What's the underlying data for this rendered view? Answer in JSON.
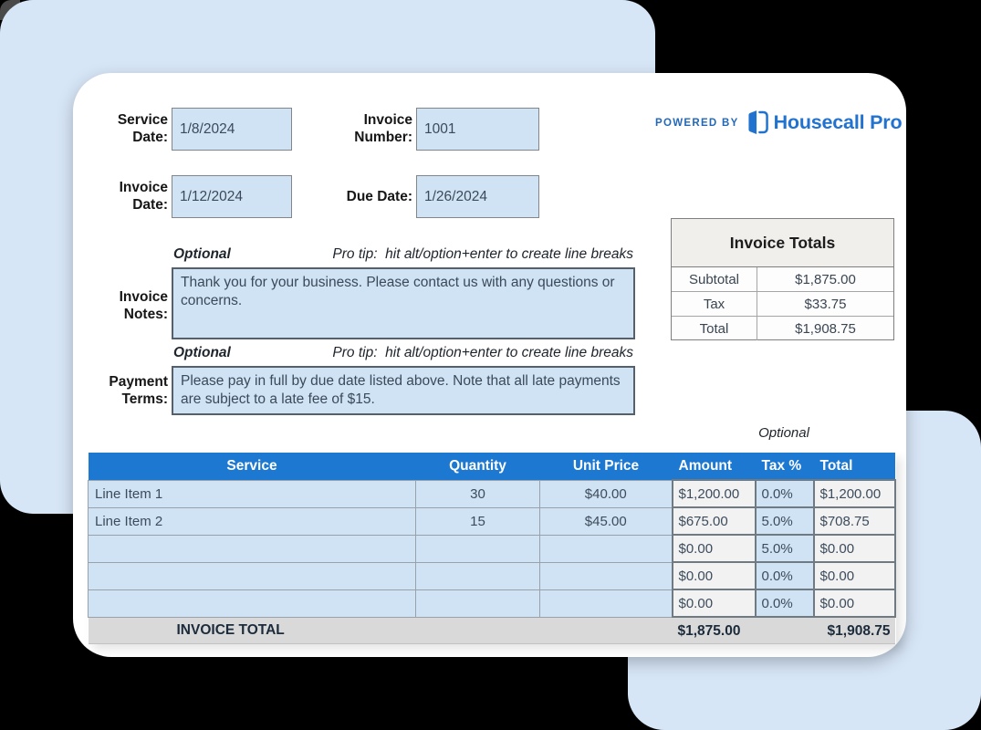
{
  "colors": {
    "brand_blue": "#2273cf",
    "table_header_blue": "#1d78d1",
    "input_cell_blue": "#cfe3f4",
    "background_blue": "#d7e6f7",
    "total_row_gray": "#d9d9d9"
  },
  "branding": {
    "powered_by": "POWERED BY",
    "brand_name": "Housecall Pro"
  },
  "fields": {
    "service_date": {
      "label_lines": [
        "Service",
        "Date:"
      ],
      "value": "1/8/2024"
    },
    "invoice_number": {
      "label_lines": [
        "Invoice",
        "Number:"
      ],
      "value": "1001"
    },
    "invoice_date": {
      "label_lines": [
        "Invoice",
        "Date:"
      ],
      "value": "1/12/2024"
    },
    "due_date": {
      "label": "Due Date:",
      "value": "1/26/2024"
    }
  },
  "invoice_totals": {
    "title": "Invoice Totals",
    "rows": [
      {
        "label": "Subtotal",
        "value": "$1,875.00"
      },
      {
        "label": "Tax",
        "value": "$33.75"
      },
      {
        "label": "Total",
        "value": "$1,908.75"
      }
    ]
  },
  "notes": {
    "optional": "Optional",
    "pro_tip": "Pro tip:  hit alt/option+enter to create line breaks",
    "label_lines": [
      "Invoice",
      "Notes:"
    ],
    "value": "Thank you for your business. Please contact us with any questions or concerns."
  },
  "payment_terms": {
    "optional": "Optional",
    "pro_tip": "Pro tip:  hit alt/option+enter to create line breaks",
    "label_lines": [
      "Payment",
      "Terms:"
    ],
    "value": "Please pay in full by due date listed above. Note that all late payments are subject to a late fee of $15."
  },
  "line_items": {
    "optional": "Optional",
    "headers": [
      "Service",
      "Quantity",
      "Unit Price",
      "Amount",
      "Tax %",
      "Total"
    ],
    "rows": [
      {
        "service": "Line Item 1",
        "quantity": "30",
        "unit_price": "$40.00",
        "amount": "$1,200.00",
        "tax": "0.0%",
        "total": "$1,200.00"
      },
      {
        "service": "Line Item 2",
        "quantity": "15",
        "unit_price": "$45.00",
        "amount": "$675.00",
        "tax": "5.0%",
        "total": "$708.75"
      },
      {
        "service": "",
        "quantity": "",
        "unit_price": "",
        "amount": "$0.00",
        "tax": "5.0%",
        "total": "$0.00"
      },
      {
        "service": "",
        "quantity": "",
        "unit_price": "",
        "amount": "$0.00",
        "tax": "0.0%",
        "total": "$0.00"
      },
      {
        "service": "",
        "quantity": "",
        "unit_price": "",
        "amount": "$0.00",
        "tax": "0.0%",
        "total": "$0.00"
      }
    ],
    "total_row": {
      "label": "INVOICE TOTAL",
      "amount": "$1,875.00",
      "total": "$1,908.75"
    }
  }
}
